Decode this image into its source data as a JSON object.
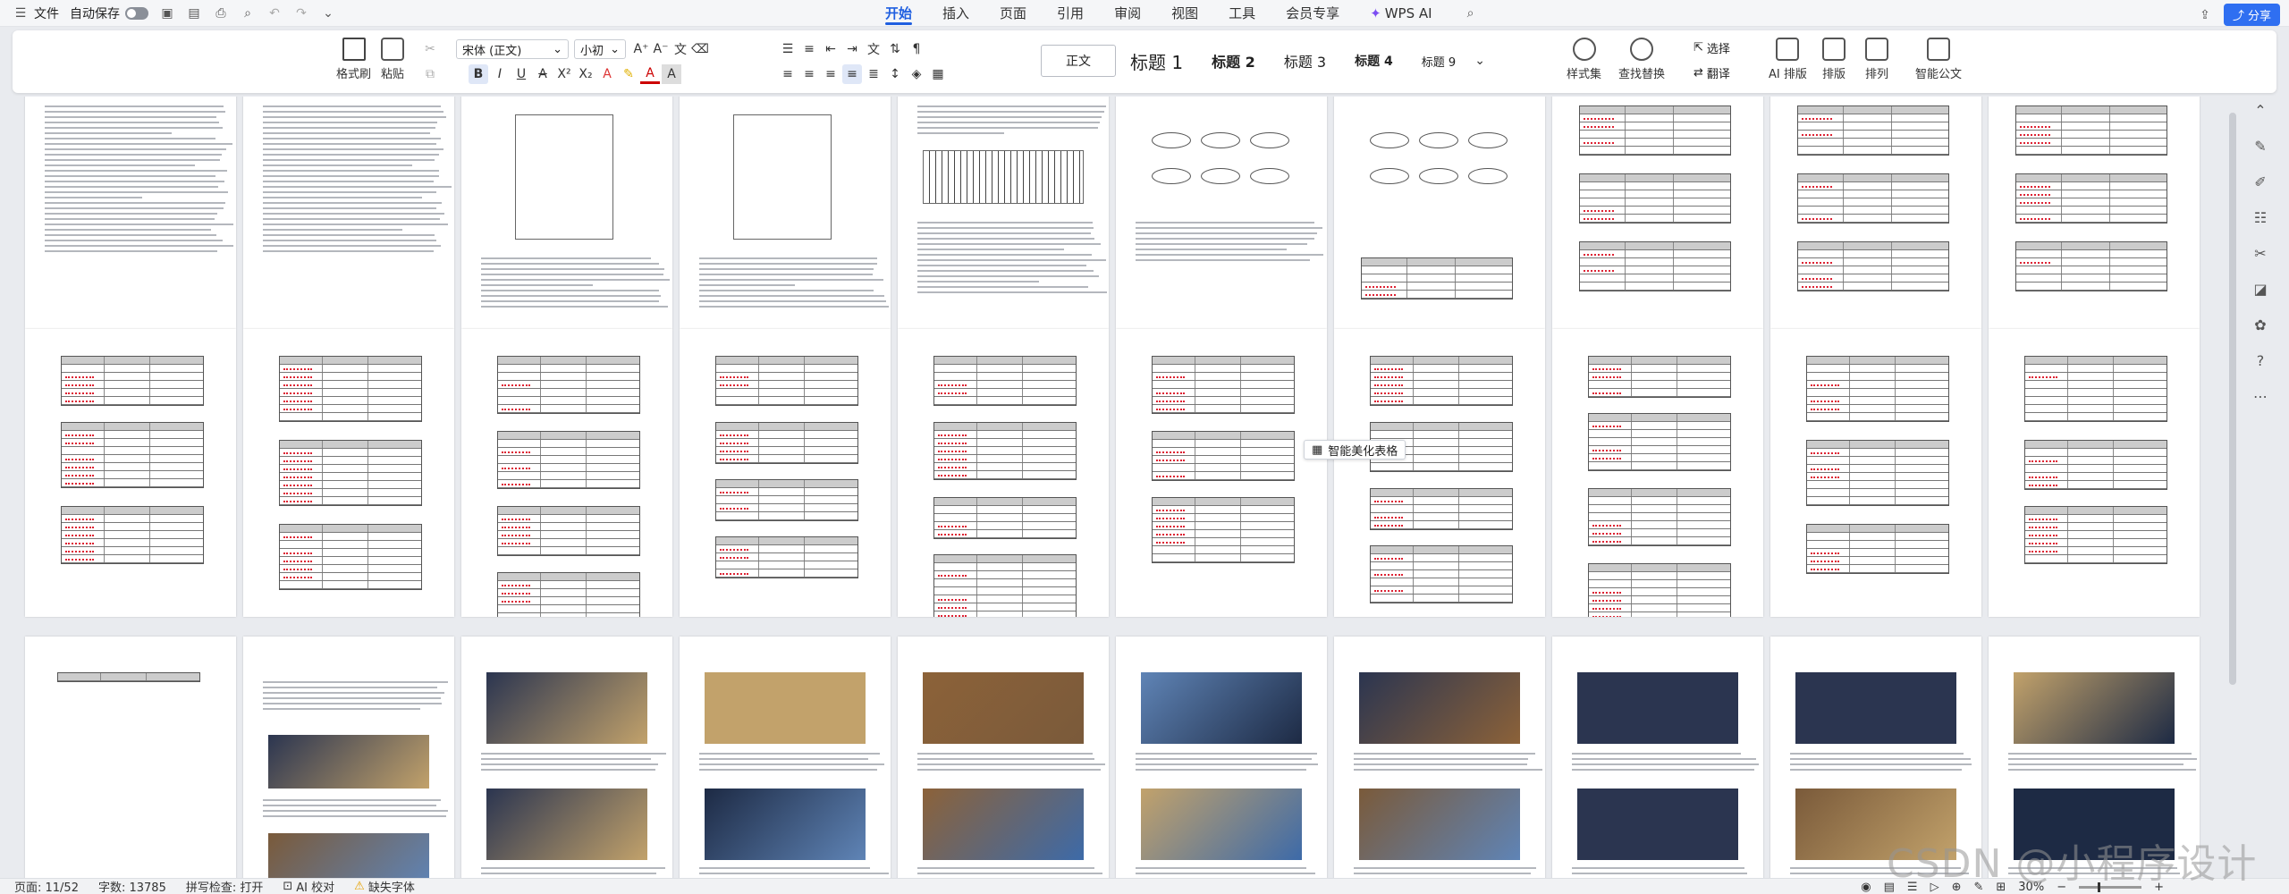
{
  "menubar": {
    "file": "文件",
    "autosave": "自动保存",
    "tabs": [
      {
        "label": "开始",
        "active": true
      },
      {
        "label": "插入"
      },
      {
        "label": "页面"
      },
      {
        "label": "引用"
      },
      {
        "label": "审阅"
      },
      {
        "label": "视图"
      },
      {
        "label": "工具"
      },
      {
        "label": "会员专享"
      },
      {
        "label": "WPS AI"
      }
    ],
    "share": "分享"
  },
  "ribbon": {
    "format_painter": "格式刷",
    "paste": "粘贴",
    "font_name": "宋体 (正文)",
    "font_size": "小初",
    "styles": [
      "正文",
      "标题 1",
      "标题 2",
      "标题 3",
      "标题 4",
      "标题 9"
    ],
    "style_set": "样式集",
    "find_replace": "查找替换",
    "select": "选择",
    "translate": "翻译",
    "ai_layout": "AI 排版",
    "layout": "排版",
    "arrange": "排列",
    "smart_doc": "智能公文"
  },
  "tooltip": {
    "label": "智能美化表格"
  },
  "status": {
    "page": "页面: 11/52",
    "words": "字数: 13785",
    "spell": "拼写检查: 打开",
    "ai_check": "AI 校对",
    "missing_font": "缺失字体",
    "zoom": "30%"
  },
  "watermark": "CSDN @小程序设计",
  "accent": "#1f5fe0"
}
